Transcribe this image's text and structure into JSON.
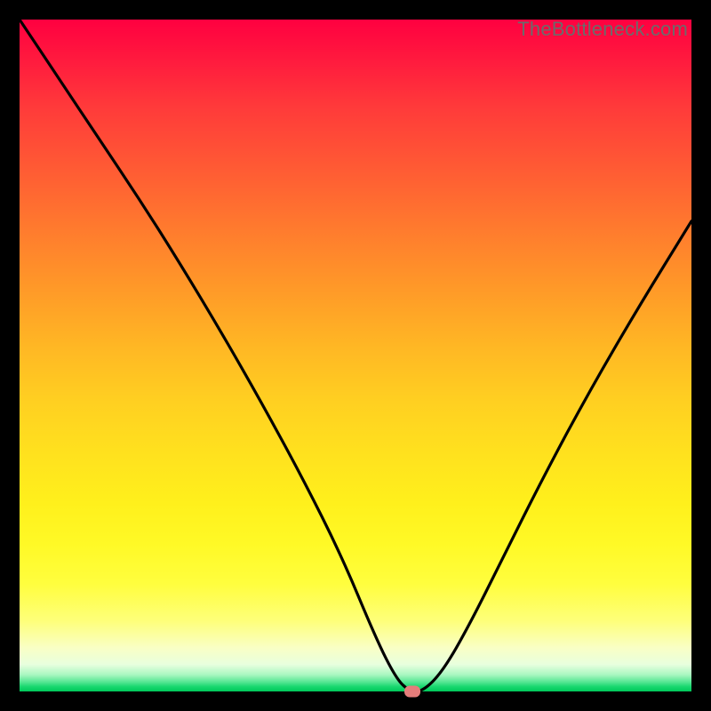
{
  "watermark": "TheBottleneck.com",
  "chart_data": {
    "type": "line",
    "title": "",
    "xlabel": "",
    "ylabel": "",
    "xlim": [
      0,
      100
    ],
    "ylim": [
      0,
      100
    ],
    "grid": false,
    "legend": false,
    "background": "rainbow-gradient",
    "series": [
      {
        "name": "bottleneck-curve",
        "color": "#000000",
        "x": [
          0,
          6,
          12,
          18,
          24,
          30,
          36,
          42,
          48,
          53,
          56,
          58,
          60,
          63,
          67,
          72,
          78,
          85,
          92,
          100
        ],
        "values": [
          100,
          91,
          82,
          73,
          63.5,
          53.5,
          43,
          32,
          20,
          8,
          2,
          0,
          0,
          3,
          10,
          20,
          32,
          45,
          57,
          70
        ]
      }
    ],
    "marker": {
      "x": 58.5,
      "y": 0,
      "color": "#e57d7b"
    }
  }
}
